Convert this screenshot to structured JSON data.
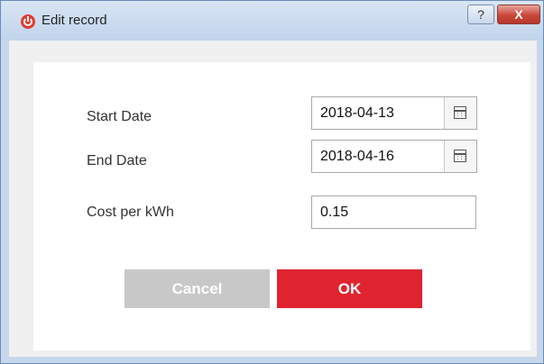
{
  "window": {
    "title": "Edit record",
    "help_label": "?",
    "close_label": "X"
  },
  "form": {
    "start_date_label": "Start Date",
    "start_date_value": "2018-04-13",
    "end_date_label": "End Date",
    "end_date_value": "2018-04-16",
    "cost_label": "Cost per kWh",
    "cost_value": "0.15"
  },
  "buttons": {
    "cancel_label": "Cancel",
    "ok_label": "OK"
  },
  "colors": {
    "accent": "#e0242f",
    "cancel": "#c8c8c8",
    "titlebar": "#c6d7ec"
  },
  "icons": {
    "app": "app-power-icon",
    "calendar": "calendar-icon"
  }
}
